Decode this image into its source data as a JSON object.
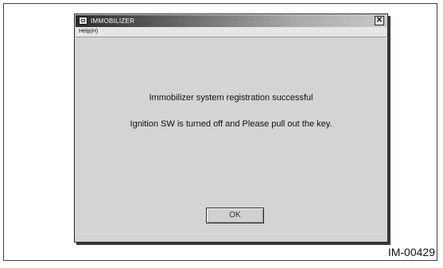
{
  "window": {
    "title": "IMMOBILIZER",
    "close_glyph": "✕",
    "app_icon": "app-icon"
  },
  "menubar": {
    "items": [
      {
        "label": "Help(H)"
      }
    ]
  },
  "dialog": {
    "message_line1": "Immobilizer system registration successful",
    "message_line2": "Ignition SW is turned off  and  Please pull out the key.",
    "ok_label": "OK"
  },
  "figure": {
    "id": "IM-00429"
  }
}
